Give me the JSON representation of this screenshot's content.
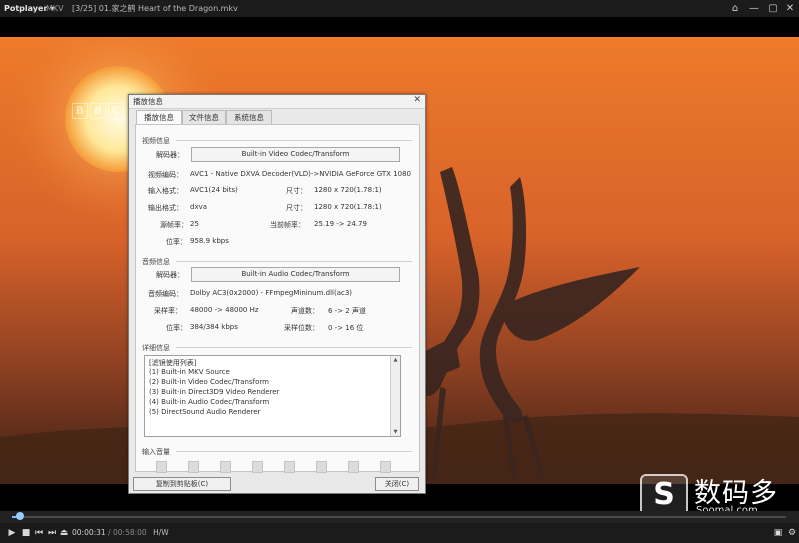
{
  "titlebar": {
    "brand": "Potplayer ▾",
    "format": "MKV",
    "filename": "[3/25] 01.家之鹤 Heart of the Dragon.mkv",
    "buttons": [
      "⌂",
      "—",
      "▢",
      "✕"
    ]
  },
  "video": {
    "channel_logo": [
      "B",
      "B",
      "C"
    ]
  },
  "watermark": {
    "logo": "S",
    "name_cn": "数码多",
    "url": "Soomal.com"
  },
  "player": {
    "progress": 0.01,
    "time_current": "00:00:31",
    "time_total": "00:58:00",
    "hw": "H/W"
  },
  "dialog": {
    "title": "播放信息",
    "close": "✕",
    "tabs": [
      "播放信息",
      "文件信息",
      "系统信息"
    ],
    "video": {
      "section": "视频信息",
      "decoder_label": "解码器：",
      "decoder": "Built-in Video Codec/Transform",
      "codec_label": "视频编码：",
      "codec": "AVC1 - Native DXVA Decoder(VLD)->NVIDIA GeForce GTX 1080",
      "input_label": "输入格式：",
      "input": "AVC1(24 bits)",
      "size_label": "尺寸：",
      "input_size": "1280 x 720(1.78:1)",
      "output_label": "输出格式：",
      "output": "dxva",
      "output_size": "1280 x 720(1.78:1)",
      "fps_label": "源帧率：",
      "fps": "25",
      "cur_fps_label": "当前帧率：",
      "cur_fps": "25.19 -> 24.79",
      "bitrate_label": "位率：",
      "bitrate": "958.9 kbps"
    },
    "audio": {
      "section": "音频信息",
      "decoder_label": "解码器：",
      "decoder": "Built-in Audio Codec/Transform",
      "codec_label": "音频编码：",
      "codec": "Dolby AC3(0x2000) - FFmpegMininum.dll(ac3)",
      "sample_label": "采样率：",
      "sample": "48000 -> 48000 Hz",
      "channels_label": "声道数：",
      "channels": "6 -> 2 声道",
      "bitrate_label": "位率：",
      "bitrate": "384/384 kbps",
      "bits_label": "采样位数：",
      "bits": "0 -> 16 位"
    },
    "details": {
      "section": "详细信息",
      "lines": [
        "[滤镜使用列表]",
        "(1) Built-in MKV Source",
        "(2) Built-in Video Codec/Transform",
        "(3) Built-in Direct3D9 Video Renderer",
        "(4) Built-in Audio Codec/Transform",
        "(5) DirectSound Audio Renderer"
      ]
    },
    "volume_section": "输入音量",
    "copy_button": "复制到剪贴板(C)",
    "close_button": "关闭(C)"
  },
  "colors": {
    "sky_top": "#f0812a",
    "sun": "#fff6d0",
    "ground": "#4a2a18"
  }
}
